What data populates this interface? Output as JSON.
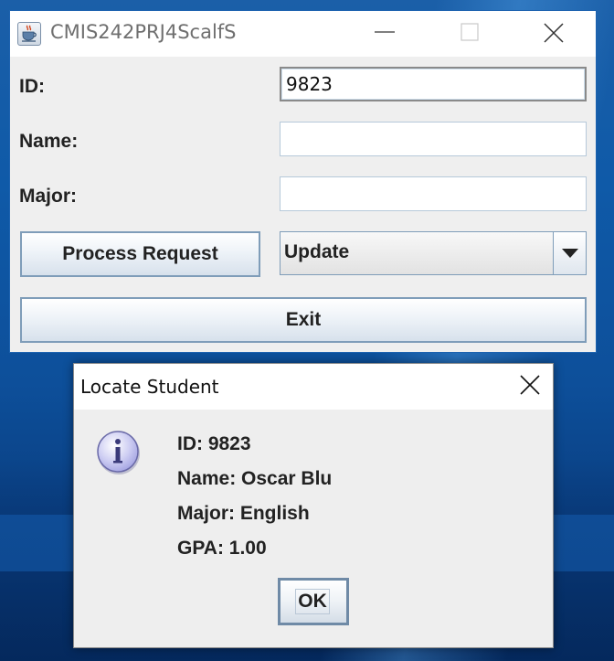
{
  "main_window": {
    "title": "CMIS242PRJ4ScalfS",
    "app_icon": "java-cup-icon",
    "controls": {
      "minimize_icon": "minimize-icon",
      "maximize_icon": "maximize-icon",
      "close_icon": "close-icon"
    },
    "form": {
      "id_label": "ID:",
      "id_value": "9823",
      "name_label": "Name:",
      "name_value": "",
      "major_label": "Major:",
      "major_value": ""
    },
    "process_button_label": "Process Request",
    "request_type": {
      "selected": "Update",
      "dropdown_icon": "triangle-down-icon"
    },
    "exit_button_label": "Exit"
  },
  "dialog": {
    "title": "Locate Student",
    "close_icon": "close-icon",
    "icon": "information-icon",
    "lines": {
      "id": "ID: 9823",
      "name": "Name: Oscar Blu",
      "major": "Major: English",
      "gpa": "GPA: 1.00"
    },
    "ok_label": "OK"
  },
  "colors": {
    "desktop_blue": "#0f5aa8",
    "window_bg": "#efefef",
    "button_border": "#7f9db9",
    "info_icon_fill": "#c8c8f0"
  }
}
